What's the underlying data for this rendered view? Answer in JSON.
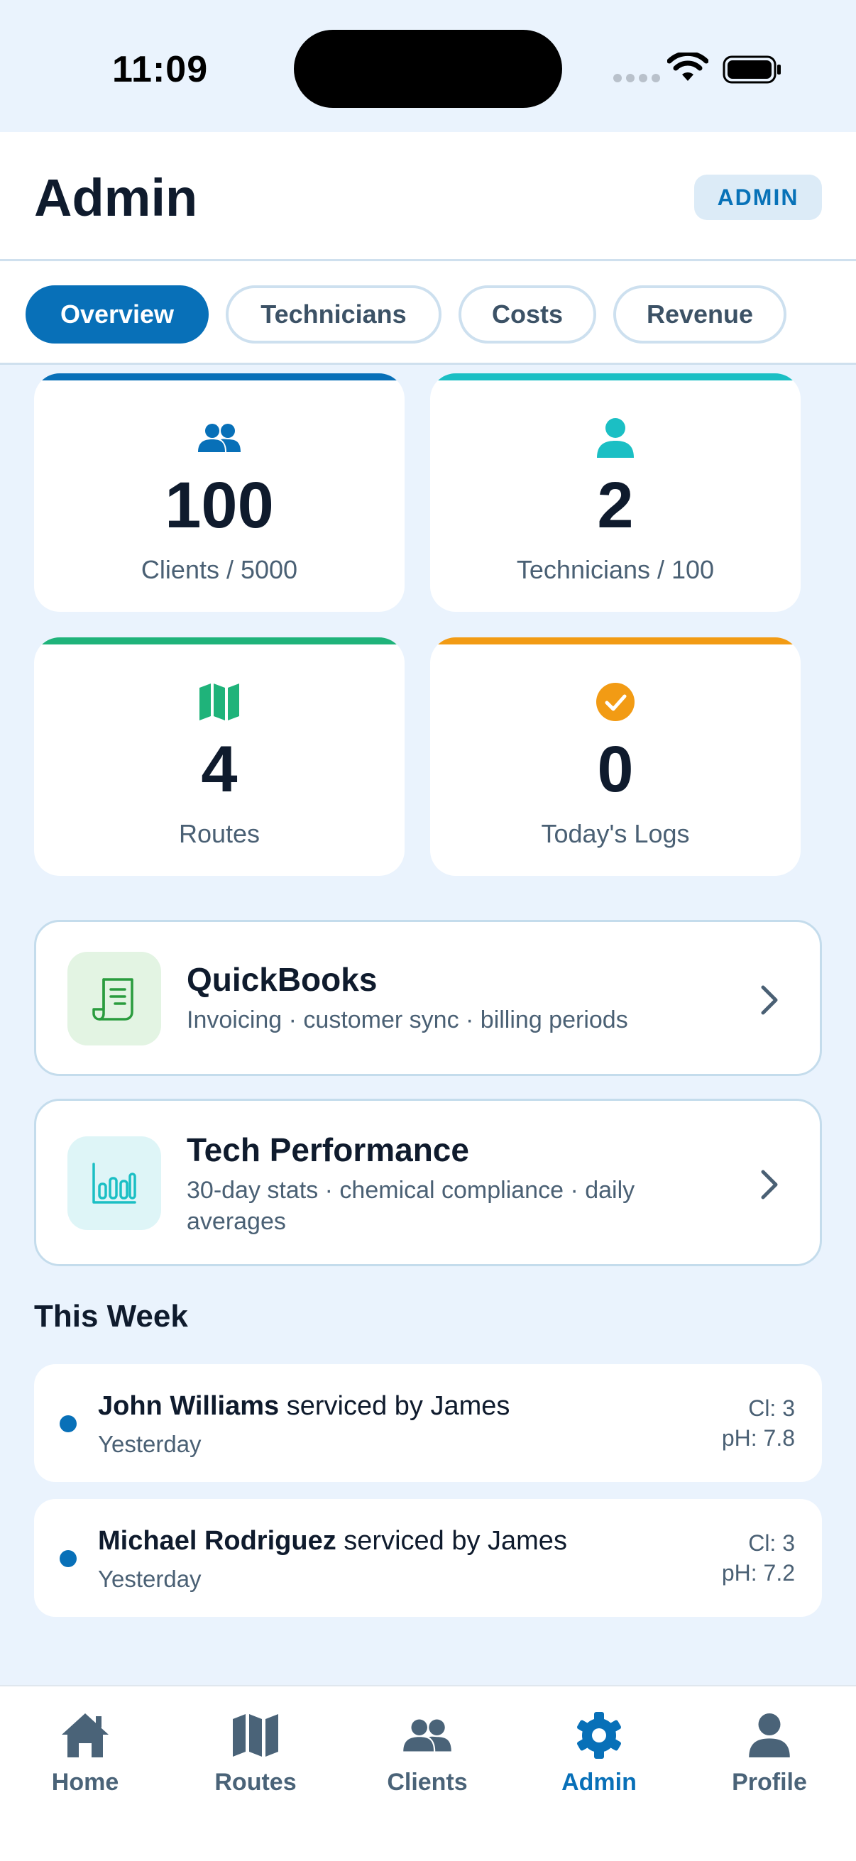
{
  "status_bar": {
    "time": "11:09"
  },
  "header": {
    "title": "Admin",
    "badge": "ADMIN"
  },
  "tabs": [
    {
      "label": "Overview",
      "active": true
    },
    {
      "label": "Technicians",
      "active": false
    },
    {
      "label": "Costs",
      "active": false
    },
    {
      "label": "Revenue",
      "active": false
    }
  ],
  "stats": [
    {
      "value": "100",
      "label": "Clients / 5000",
      "accent": "#0870b8",
      "icon": "users-icon"
    },
    {
      "value": "2",
      "label": "Technicians / 100",
      "accent": "#1bbfc4",
      "icon": "person-icon"
    },
    {
      "value": "4",
      "label": "Routes",
      "accent": "#1fb37a",
      "icon": "map-icon"
    },
    {
      "value": "0",
      "label": "Today's Logs",
      "accent": "#f29b14",
      "icon": "check-circle-icon"
    }
  ],
  "links": [
    {
      "title": "QuickBooks",
      "subtitle": "Invoicing · customer sync · billing periods",
      "icon": "receipt-icon"
    },
    {
      "title": "Tech Performance",
      "subtitle": "30-day stats · chemical compliance · daily averages",
      "icon": "bar-chart-icon"
    }
  ],
  "this_week": {
    "title": "This Week",
    "logs": [
      {
        "client": "John Williams",
        "action": " serviced by James",
        "time": "Yesterday",
        "cl": "Cl: 3",
        "ph": "pH: 7.8"
      },
      {
        "client": "Michael Rodriguez",
        "action": " serviced by James",
        "time": "Yesterday",
        "cl": "Cl: 3",
        "ph": "pH: 7.2"
      }
    ]
  },
  "nav": [
    {
      "label": "Home",
      "icon": "home-icon",
      "active": false
    },
    {
      "label": "Routes",
      "icon": "map-icon",
      "active": false
    },
    {
      "label": "Clients",
      "icon": "users-icon",
      "active": false
    },
    {
      "label": "Admin",
      "icon": "gear-icon",
      "active": true
    },
    {
      "label": "Profile",
      "icon": "person-icon",
      "active": false
    }
  ],
  "colors": {
    "primary": "#0870b8",
    "background": "#eaf3fd"
  }
}
